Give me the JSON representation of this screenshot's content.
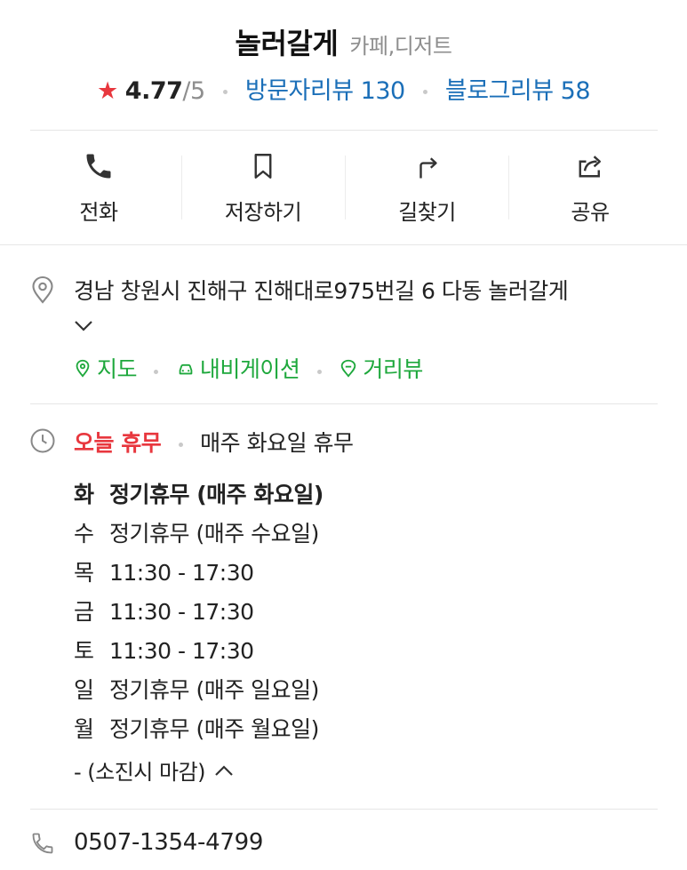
{
  "place": {
    "name": "놀러갈게",
    "category": "카페,디저트"
  },
  "rating": {
    "score": "4.77",
    "max": "/5",
    "visitor_reviews": "방문자리뷰 130",
    "blog_reviews": "블로그리뷰 58"
  },
  "actions": [
    {
      "label": "전화",
      "icon": "phone-icon"
    },
    {
      "label": "저장하기",
      "icon": "bookmark-icon"
    },
    {
      "label": "길찾기",
      "icon": "directions-icon"
    },
    {
      "label": "공유",
      "icon": "share-icon"
    }
  ],
  "address": {
    "text": "경남 창원시 진해구 진해대로975번길 6 다동 놀러갈게",
    "links": {
      "map": "지도",
      "navigation": "내비게이션",
      "street_view": "거리뷰"
    }
  },
  "hours": {
    "status": "오늘 휴무",
    "note": "매주 화요일 휴무",
    "rows": [
      {
        "day": "화",
        "value": "정기휴무 (매주 화요일)"
      },
      {
        "day": "수",
        "value": "정기휴무 (매주 수요일)"
      },
      {
        "day": "목",
        "value": "11:30 - 17:30"
      },
      {
        "day": "금",
        "value": "11:30 - 17:30"
      },
      {
        "day": "토",
        "value": "11:30 - 17:30"
      },
      {
        "day": "일",
        "value": "정기휴무 (매주 일요일)"
      },
      {
        "day": "월",
        "value": "정기휴무 (매주 월요일)"
      }
    ],
    "footnote": "- (소진시 마감)"
  },
  "phone": {
    "number": "0507-1354-4799"
  },
  "colors": {
    "accent_red": "#e8373e",
    "link_blue": "#1b6fb8",
    "link_green": "#1ea83c",
    "muted": "#8e8e8e"
  }
}
